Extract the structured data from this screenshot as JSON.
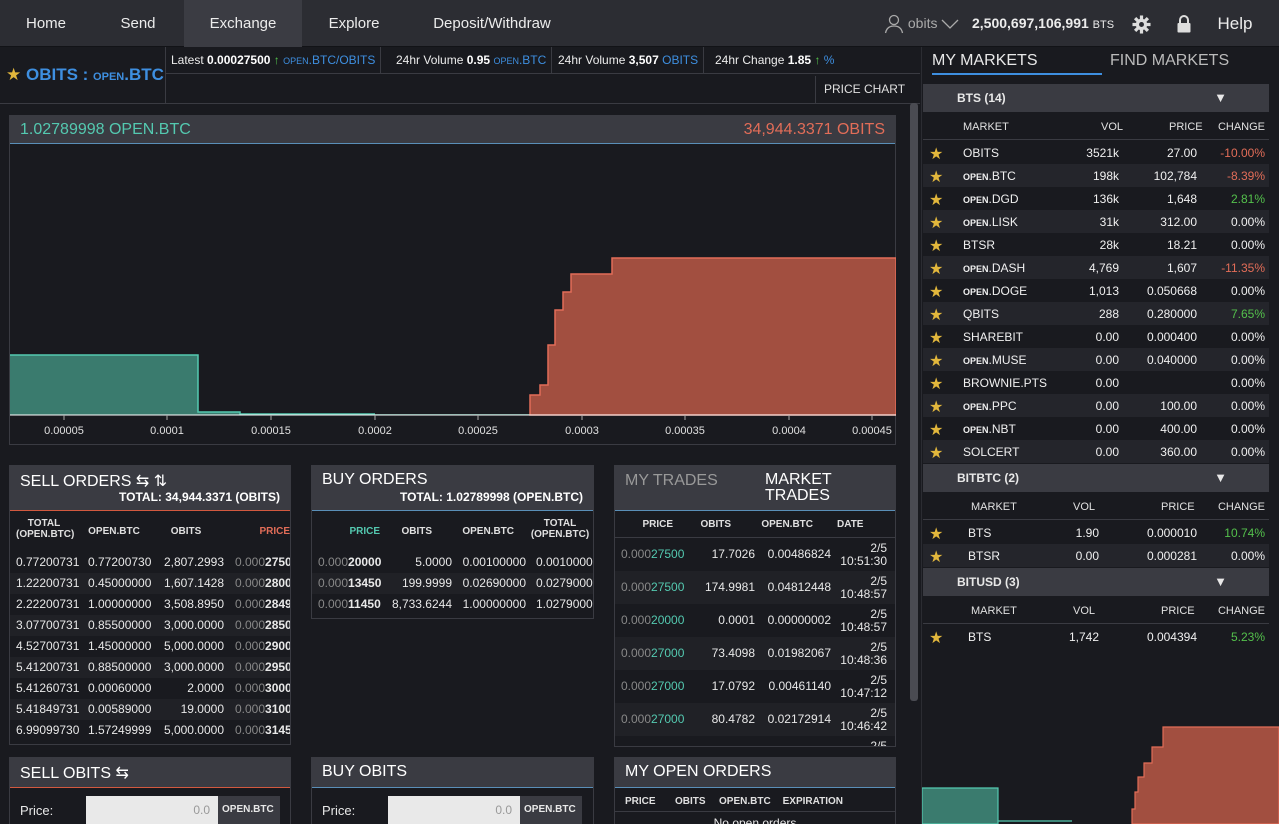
{
  "nav": {
    "home": "Home",
    "send": "Send",
    "exchange": "Exchange",
    "explore": "Explore",
    "deposit": "Deposit/Withdraw",
    "account": "obits",
    "balance": "2,500,697,106,991",
    "balance_unit": "BTS",
    "help": "Help"
  },
  "market": {
    "base": "OBITS",
    "sep": " : ",
    "quote_prefix": "OPEN",
    "quote_suffix": ".BTC"
  },
  "stats": {
    "latest_label": "Latest",
    "latest_value": "0.00027500",
    "latest_unit_a": "OPEN",
    "latest_unit_b": ".BTC/OBITS",
    "vol1_label": "24hr Volume",
    "vol1_value": "0.95",
    "vol1_unit_a": "OPEN",
    "vol1_unit_b": ".BTC",
    "vol2_label": "24hr Volume",
    "vol2_value": "3,507",
    "vol2_unit": "OBITS",
    "chg_label": "24hr Change",
    "chg_value": "1.85",
    "chg_unit": "%",
    "price_chart": "PRICE CHART",
    "arrow": "↑"
  },
  "depth": {
    "bid_total": "1.02789998 OPEN.BTC",
    "ask_total": "34,944.3371 OBITS",
    "ticks": [
      "0.00005",
      "0.0001",
      "0.00015",
      "0.0002",
      "0.00025",
      "0.0003",
      "0.00035",
      "0.0004",
      "0.00045"
    ]
  },
  "sell_orders": {
    "title": "SELL ORDERS ⇆ ⇅",
    "total": "TOTAL: 34,944.3371 (OBITS)",
    "headers": [
      "TOTAL (OPEN.BTC)",
      "OPEN.BTC",
      "OBITS",
      "PRICE"
    ],
    "rows": [
      [
        "0.77200731",
        "0.77200730",
        "2,807.2993",
        "0.000",
        "2750"
      ],
      [
        "1.22200731",
        "0.45000000",
        "1,607.1428",
        "0.000",
        "2800"
      ],
      [
        "2.22200731",
        "1.00000000",
        "3,508.8950",
        "0.000",
        "2849"
      ],
      [
        "3.07700731",
        "0.85500000",
        "3,000.0000",
        "0.000",
        "2850"
      ],
      [
        "4.52700731",
        "1.45000000",
        "5,000.0000",
        "0.000",
        "2900"
      ],
      [
        "5.41200731",
        "0.88500000",
        "3,000.0000",
        "0.000",
        "2950"
      ],
      [
        "5.41260731",
        "0.00060000",
        "2.0000",
        "0.000",
        "3000"
      ],
      [
        "5.41849731",
        "0.00589000",
        "19.0000",
        "0.000",
        "3100"
      ],
      [
        "6.99099730",
        "1.57249999",
        "5,000.0000",
        "0.000",
        "3145"
      ]
    ]
  },
  "buy_orders": {
    "title": "BUY ORDERS",
    "total": "TOTAL: 1.02789998 (OPEN.BTC)",
    "headers": [
      "PRICE",
      "OBITS",
      "OPEN.BTC",
      "TOTAL (OPEN.BTC)"
    ],
    "rows": [
      [
        "0.000",
        "20000",
        "5.0000",
        "0.00100000",
        "0.0010000"
      ],
      [
        "0.000",
        "13450",
        "199.9999",
        "0.02690000",
        "0.0279000"
      ],
      [
        "0.000",
        "11450",
        "8,733.6244",
        "1.00000000",
        "1.0279000"
      ]
    ]
  },
  "trades": {
    "tab_my": "MY TRADES",
    "tab_market": "MARKET TRADES",
    "headers": [
      "PRICE",
      "OBITS",
      "OPEN.BTC",
      "DATE"
    ],
    "rows": [
      [
        "0.000",
        "27500",
        "17.7026",
        "0.00486824",
        "2/5",
        "10:51:30"
      ],
      [
        "0.000",
        "27500",
        "174.9981",
        "0.04812448",
        "2/5",
        "10:48:57"
      ],
      [
        "0.000",
        "20000",
        "0.0001",
        "0.00000002",
        "2/5",
        "10:48:57"
      ],
      [
        "0.000",
        "27000",
        "73.4098",
        "0.01982067",
        "2/5",
        "10:48:36"
      ],
      [
        "0.000",
        "27000",
        "17.0792",
        "0.00461140",
        "2/5",
        "10:47:12"
      ],
      [
        "0.000",
        "27000",
        "80.4782",
        "0.02172914",
        "2/5",
        "10:46:42"
      ]
    ],
    "more_date": "2/5"
  },
  "sell_form": {
    "title": "SELL OBITS ⇆",
    "price_label": "Price:",
    "price_value": "0.0",
    "unit": "OPEN.BTC"
  },
  "buy_form": {
    "title": "BUY OBITS",
    "price_label": "Price:",
    "price_value": "0.0",
    "unit": "OPEN.BTC"
  },
  "open_orders": {
    "title": "MY OPEN ORDERS",
    "headers": [
      "PRICE",
      "OBITS",
      "OPEN.BTC",
      "EXPIRATION"
    ],
    "empty": "No open orders"
  },
  "markets_panel": {
    "tab_my": "MY MARKETS",
    "tab_find": "FIND MARKETS",
    "col_market": "MARKET",
    "col_vol": "VOL",
    "col_price": "PRICE",
    "col_change": "CHANGE",
    "star": "★",
    "caret": "▼",
    "groups": [
      {
        "name": "BTS (14)",
        "rows": [
          [
            "",
            "OBITS",
            "3521k",
            "27.00",
            "-10.00%"
          ],
          [
            "OPEN",
            ".BTC",
            "198k",
            "102,784",
            "-8.39%"
          ],
          [
            "OPEN",
            ".DGD",
            "136k",
            "1,648",
            "2.81%"
          ],
          [
            "OPEN",
            ".LISK",
            "31k",
            "312.00",
            "0.00%"
          ],
          [
            "",
            "BTSR",
            "28k",
            "18.21",
            "0.00%"
          ],
          [
            "OPEN",
            ".DASH",
            "4,769",
            "1,607",
            "-11.35%"
          ],
          [
            "OPEN",
            ".DOGE",
            "1,013",
            "0.050668",
            "0.00%"
          ],
          [
            "",
            "QBITS",
            "288",
            "0.280000",
            "7.65%"
          ],
          [
            "",
            "SHAREBIT",
            "0.00",
            "0.000400",
            "0.00%"
          ],
          [
            "OPEN",
            ".MUSE",
            "0.00",
            "0.040000",
            "0.00%"
          ],
          [
            "",
            "BROWNIE.PTS",
            "0.00",
            "",
            "0.00%"
          ],
          [
            "OPEN",
            ".PPC",
            "0.00",
            "100.00",
            "0.00%"
          ],
          [
            "OPEN",
            ".NBT",
            "0.00",
            "400.00",
            "0.00%"
          ],
          [
            "",
            "SOLCERT",
            "0.00",
            "360.00",
            "0.00%"
          ]
        ]
      },
      {
        "name": "BITBTC (2)",
        "rows": [
          [
            "",
            "BTS",
            "1.90",
            "0.000010",
            "10.74%"
          ],
          [
            "",
            "BTSR",
            "0.00",
            "0.000281",
            "0.00%"
          ]
        ]
      },
      {
        "name": "BITUSD (3)",
        "rows": [
          [
            "",
            "BTS",
            "1,742",
            "0.004394",
            "5.23%"
          ]
        ]
      }
    ]
  }
}
